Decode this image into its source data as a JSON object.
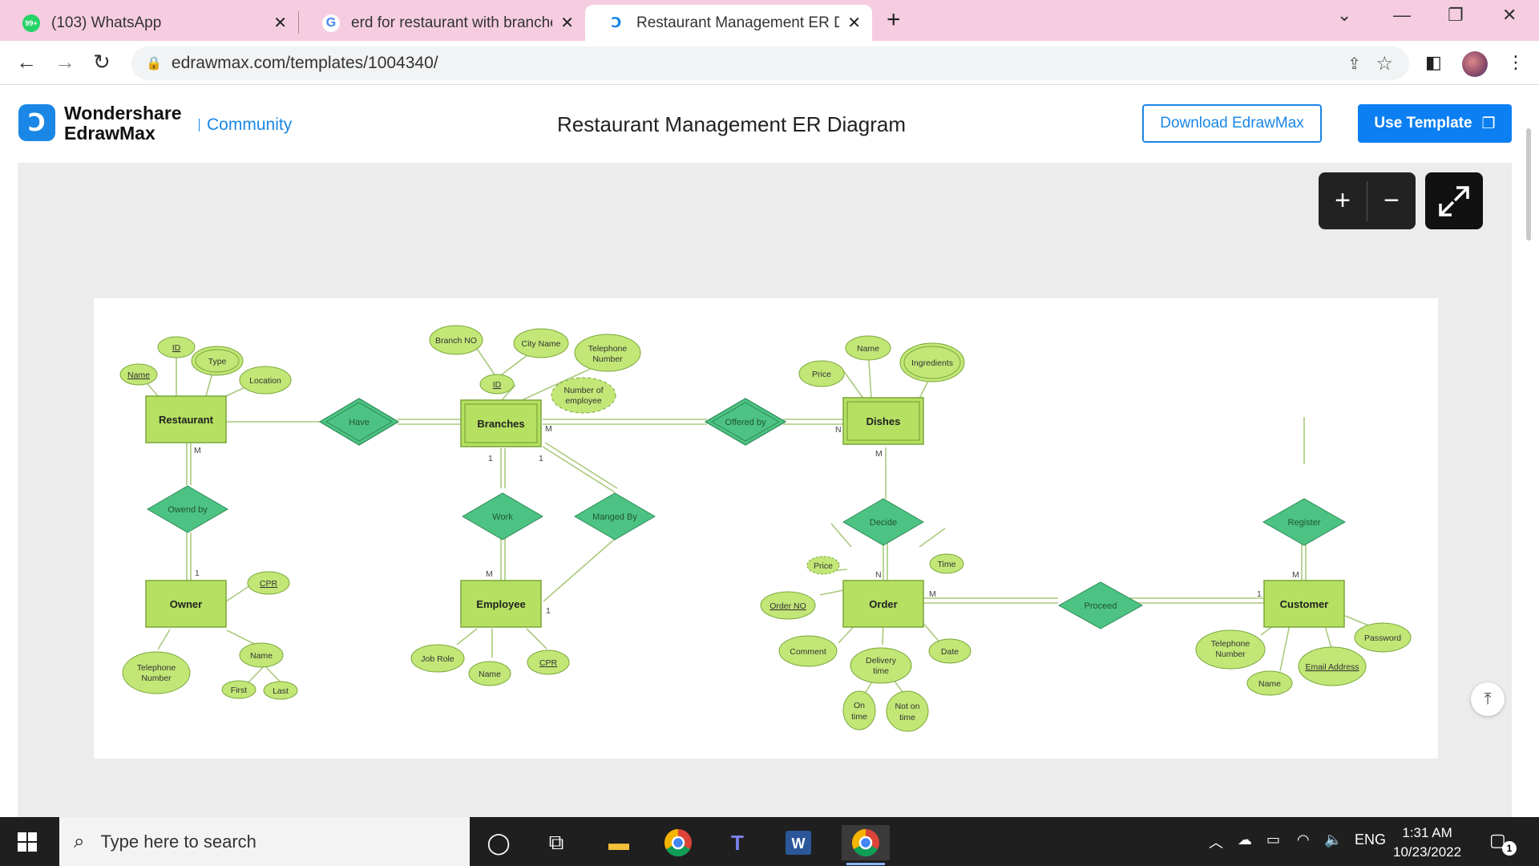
{
  "browser": {
    "tabs": [
      {
        "title": "(103) WhatsApp",
        "favicon": "whatsapp-icon",
        "badge": "99+"
      },
      {
        "title": "erd for restaurant with branches",
        "favicon": "google-icon"
      },
      {
        "title": "Restaurant Management ER Diag",
        "favicon": "edrawmax-icon",
        "active": true
      }
    ],
    "url": "edrawmax.com/templates/1004340/"
  },
  "site": {
    "brand_line1": "Wondershare",
    "brand_line2": "EdrawMax",
    "community": "Community",
    "page_title": "Restaurant Management ER Diagram",
    "download_label": "Download EdrawMax",
    "use_template_label": "Use Template"
  },
  "diagram": {
    "entities": {
      "restaurant": "Restaurant",
      "branches": "Branches",
      "dishes": "Dishes",
      "owner": "Owner",
      "employee": "Employee",
      "order": "Order",
      "customer": "Customer"
    },
    "relationships": {
      "have": "Have",
      "offered_by": "Offered by",
      "owned_by": "Owend by",
      "work": "Work",
      "managed_by": "Manged By",
      "decide": "Decide",
      "proceed": "Proceed",
      "register": "Register"
    },
    "attributes": {
      "r_id": "ID",
      "r_type": "Type",
      "r_name": "Name",
      "r_location": "Location",
      "b_branch_no": "Branch NO",
      "b_city": "City Name",
      "b_tel_1": "Telephone",
      "b_tel_2": "Number",
      "b_id": "ID",
      "b_num_1": "Number of",
      "b_num_2": "employee",
      "d_name": "Name",
      "d_price": "Price",
      "d_ingredients": "Ingredients",
      "o_cpr": "CPR",
      "o_tel_1": "Telephone",
      "o_tel_2": "Number",
      "o_name": "Name",
      "o_first": "First",
      "o_last": "Last",
      "e_job": "Job Role",
      "e_name": "Name",
      "e_cpr": "CPR",
      "or_price": "Price",
      "or_time": "Time",
      "or_order_no": "Order NO",
      "or_comment": "Comment",
      "or_delivery_1": "Delivery",
      "or_delivery_2": "time",
      "or_date": "Date",
      "or_ontime_1": "On",
      "or_ontime_2": "time",
      "or_noton_1": "Not on",
      "or_noton_2": "time",
      "c_tel_1": "Telephone",
      "c_tel_2": "Number",
      "c_password": "Password",
      "c_email": "Email Address",
      "c_name": "Name"
    },
    "cardinality": {
      "restaurant_owned": "M",
      "owner_owned": "1",
      "branches_have": "M",
      "branches_work": "1",
      "branches_managed": "1",
      "employee_work": "M",
      "employee_managed": "1",
      "dishes_offered": "N",
      "dishes_decide": "M",
      "order_decide": "N",
      "order_proceed": "M",
      "customer_proceed": "1",
      "customer_register": "M"
    }
  },
  "taskbar": {
    "search_placeholder": "Type here to search",
    "language": "ENG",
    "time": "1:31 AM",
    "date": "10/23/2022",
    "notifications": "1"
  },
  "colors": {
    "entity_fill": "#b5e061",
    "entity_stroke": "#7aa63a",
    "attribute_fill": "#c2e777",
    "relationship_fill": "#4cc382",
    "accent": "#1a87e6"
  }
}
